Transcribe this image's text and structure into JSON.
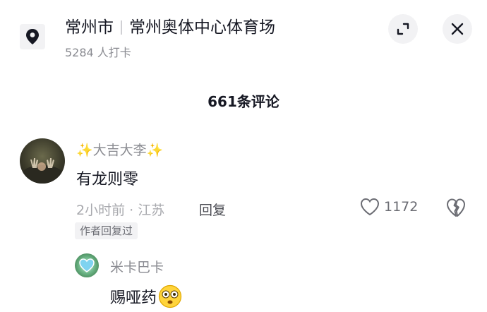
{
  "header": {
    "city": "常州市",
    "venue": "常州奥体中心体育场",
    "checkins": "5284 人打卡",
    "location_icon": "location-pin-icon",
    "expand_icon": "expand-icon",
    "close_icon": "close-icon"
  },
  "comments_header": {
    "count_label": "661条评论"
  },
  "comment": {
    "username": "✨大吉大李✨",
    "text": "有龙则零",
    "meta": "2小时前 · 江苏",
    "reply_label": "回复",
    "like_count": "1172",
    "author_badge": "作者回复过"
  },
  "reply": {
    "username": "米卡巴卡",
    "text": "赐哑药",
    "emoji": "dizzy-face-emoji"
  },
  "colors": {
    "primary_text": "#161823",
    "secondary_text": "#8a8b91",
    "button_bg": "#f2f2f4"
  }
}
